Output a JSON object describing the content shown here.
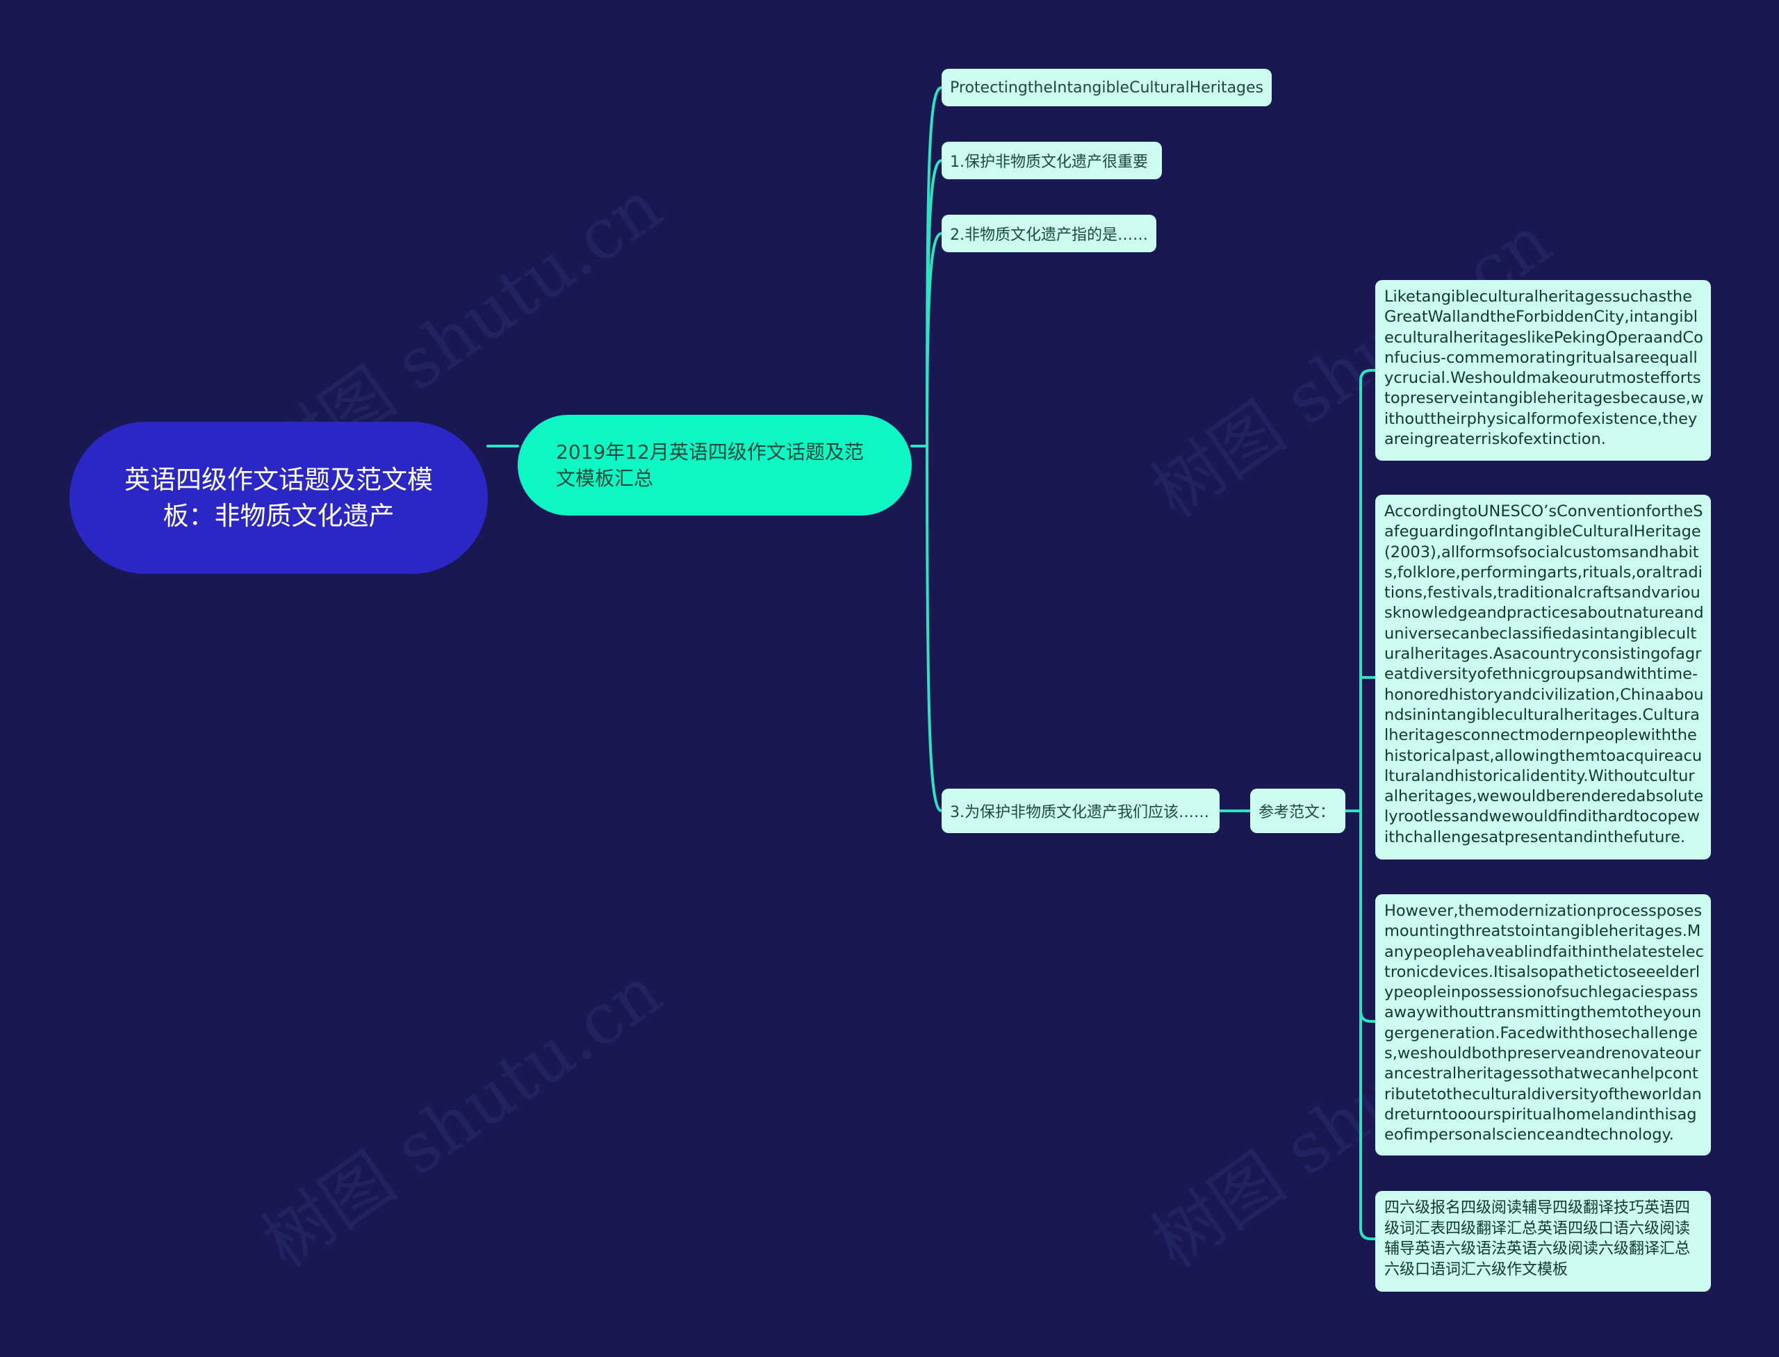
{
  "watermark": "树图 shutu.cn",
  "colors": {
    "background": "#1a1852",
    "root_fill": "#2a27c4",
    "level1_fill": "#0ef6c4",
    "node_fill": "#ccfbef",
    "link": "#2de3c0",
    "text_dark": "#1d4a3a",
    "text_light": "#ffffff"
  },
  "root": {
    "label": "英语四级作文话题及范文模板：非物质文化遗产"
  },
  "branch": {
    "label": "2019年12月英语四级作文话题及范文模板汇总",
    "children": [
      {
        "label": "ProtectingtheIntangibleCulturalHeritages"
      },
      {
        "label": "1.保护非物质文化遗产很重要"
      },
      {
        "label": "2.非物质文化遗产指的是……"
      },
      {
        "label": "3.为保护非物质文化遗产我们应该……",
        "child": {
          "label": "参考范文：",
          "paragraphs": [
            "LiketangibleculturalheritagessuchastheGreatWallandtheForbiddenCity,intangibleculturalheritageslikePekingOperaandConfucius-commemoratingritualsareequallycrucial.Weshouldmakeourutmosteffortstopreserveintangibleheritagesbecause,withouttheirphysicalformofexistence,theyareingreaterriskofextinction.",
            "AccordingtoUNESCO’sConventionfortheSafeguardingofIntangibleCulturalHeritage(2003),allformsofsocialcustomsandhabits,folklore,performingarts,rituals,oraltraditions,festivals,traditionalcraftsandvariousknowledgeandpracticesaboutnatureanduniversecanbeclassifiedasintangibleculturalheritages.Asacountryconsistingofagreatdiversityofethnicgroupsandwithtime-honoredhistoryandcivilization,Chinaaboundsinintangibleculturalheritages.Culturalheritagesconnectmodernpeoplewiththehistoricalpast,allowingthemtoacquireaculturalandhistoricalidentity.Withoutculturalheritages,wewouldberenderedabsolutelyrootlessandwewouldfindithardtocopewithchallengesatpresentandinthefuture.",
            "However,themodernizationprocessposesmountingthreatstointangibleheritages.Manypeoplehaveablindfaithinthelatestelectronicdevices.Itisalsopathetictoseeelderlypeopleinpossessionofsuchlegaciespassawaywithouttransmittingthemtotheyoungergeneration.Facedwiththosechallenges,weshouldbothpreserveandrenovateourancestralheritagessothatwecanhelpcontributetotheculturaldiversityoftheworldandreturntooourspiritualhomelandinthisageofimpersonalscienceandtechnology.",
            "四六级报名四级阅读辅导四级翻译技巧英语四级词汇表四级翻译汇总英语四级口语六级阅读辅导英语六级语法英语六级阅读六级翻译汇总六级口语词汇六级作文模板"
          ]
        }
      }
    ]
  }
}
